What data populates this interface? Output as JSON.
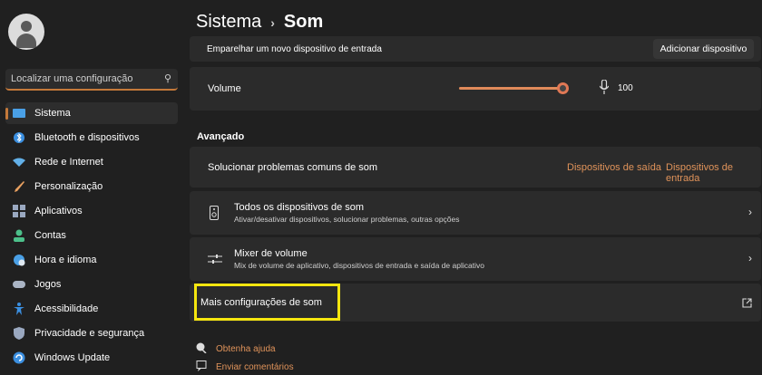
{
  "header": {
    "parent": "Sistema",
    "separator": "›",
    "current": "Som"
  },
  "search": {
    "placeholder": "Localizar uma configuração"
  },
  "sidebar": {
    "items": [
      {
        "label": "Sistema",
        "icon": "monitor-icon",
        "color": "#4aa0e6"
      },
      {
        "label": "Bluetooth e dispositivos",
        "icon": "bluetooth-icon",
        "color": "#3b8fe0"
      },
      {
        "label": "Rede e Internet",
        "icon": "wifi-icon",
        "color": "#62b0e8"
      },
      {
        "label": "Personalização",
        "icon": "brush-icon",
        "color": "#e8a060"
      },
      {
        "label": "Aplicativos",
        "icon": "apps-icon",
        "color": "#9aa8c0"
      },
      {
        "label": "Contas",
        "icon": "person-icon",
        "color": "#4cc08a"
      },
      {
        "label": "Hora e idioma",
        "icon": "globe-clock-icon",
        "color": "#4aa0e6"
      },
      {
        "label": "Jogos",
        "icon": "gamepad-icon",
        "color": "#aab4c4"
      },
      {
        "label": "Acessibilidade",
        "icon": "accessibility-icon",
        "color": "#3b8fe0"
      },
      {
        "label": "Privacidade e segurança",
        "icon": "shield-icon",
        "color": "#9aa8c0"
      },
      {
        "label": "Windows Update",
        "icon": "update-icon",
        "color": "#3b8fe0"
      }
    ]
  },
  "pairing": {
    "label": "Emparelhar um novo dispositivo de entrada",
    "button": "Adicionar dispositivo"
  },
  "volume": {
    "label": "Volume",
    "value": "100",
    "level": 1.0
  },
  "advanced": {
    "title": "Avançado",
    "troubleshoot": {
      "label": "Solucionar problemas comuns de som",
      "output_link": "Dispositivos de saída",
      "input_link": "Dispositivos de entrada"
    },
    "all_devices": {
      "title": "Todos os dispositivos de som",
      "subtitle": "Ativar/desativar dispositivos, solucionar problemas, outras opções"
    },
    "mixer": {
      "title": "Mixer de volume",
      "subtitle": "Mix de volume de aplicativo, dispositivos de entrada e saída de aplicativo"
    },
    "more_settings": {
      "title": "Mais configurações de som"
    }
  },
  "footer": {
    "help": "Obtenha ajuda",
    "feedback": "Enviar comentários"
  },
  "colors": {
    "accent": "#e0935a",
    "highlight": "#f5e60f",
    "background": "#202020",
    "card": "#2b2b2b"
  }
}
